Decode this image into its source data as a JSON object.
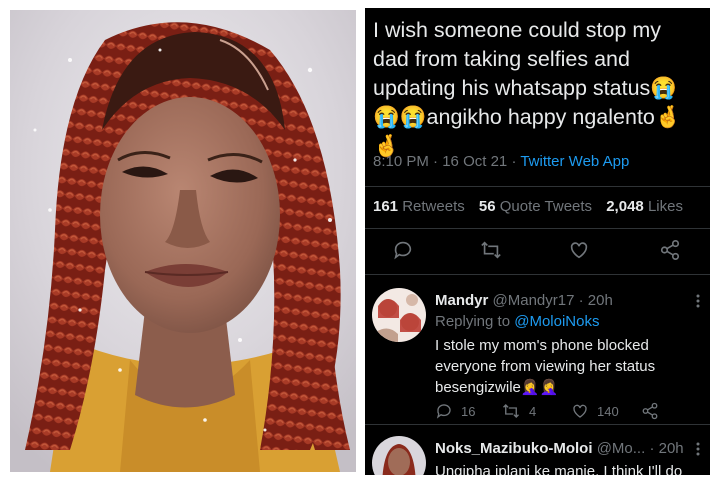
{
  "photo": {
    "description_icon": "woman-selfie-photo"
  },
  "tweet": {
    "text_line1": "I wish someone could stop my",
    "text_line2": "dad from taking selfies and",
    "text_line3": "updating his whatsapp status😭",
    "text_line4": "😭😭angikho happy ngalento🤞",
    "text_line5": "🤞",
    "time": "8:10 PM",
    "dot": "·",
    "date": "16 Oct 21",
    "source": "Twitter Web App",
    "retweets_count": "161",
    "retweets_label": "Retweets",
    "quotes_count": "56",
    "quotes_label": "Quote Tweets",
    "likes_count": "2,048",
    "likes_label": "Likes"
  },
  "replies": [
    {
      "name": "Mandyr",
      "handle": "@Mandyr17",
      "time": "· 20h",
      "replying_label": "Replying to",
      "replying_to": "@MoloiNoks",
      "text_line1": "I stole my mom's phone blocked",
      "text_line2": "everyone from viewing her status",
      "text_line3": "besengizwile🤦‍♀️🤦‍♀️",
      "reply_count": "16",
      "retweet_count": "4",
      "like_count": "140"
    },
    {
      "name": "Noks_Mazibuko-Moloi",
      "handle": "@Mo...",
      "time": "· 20h",
      "text_line1": "Ungipha iplani ke manje, I think I'll do"
    }
  ],
  "colors": {
    "background": "#000000",
    "text": "#e7e9ea",
    "muted": "#71767b",
    "link": "#1d9bf0",
    "divider": "#2f3336"
  }
}
